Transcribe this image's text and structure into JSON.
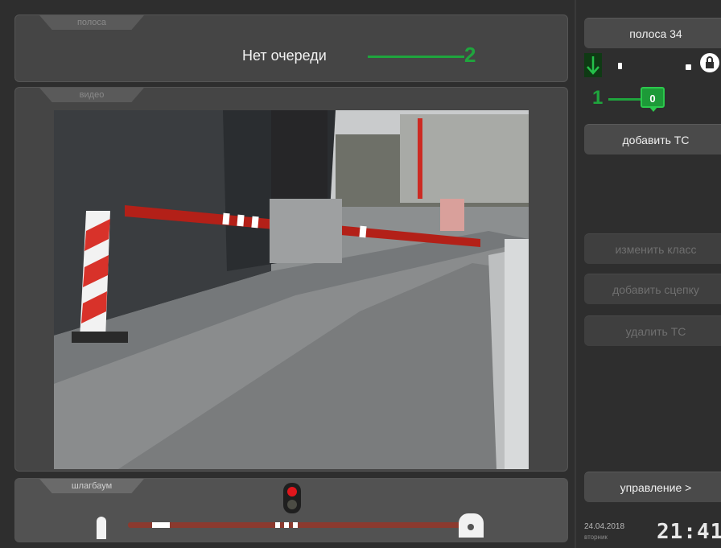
{
  "lane_panel": {
    "tab_label": "полоса",
    "queue_text": "Нет очереди",
    "callout_number": "2"
  },
  "video_panel": {
    "tab_label": "видео"
  },
  "barrier_panel": {
    "tab_label": "шлагбаум",
    "traffic_light_state": "red"
  },
  "sidebar": {
    "lane_button": "полоса 34",
    "callout_number": "1",
    "vehicle_count": "0",
    "add_vehicle_button": "добавить ТС",
    "change_class_button": "изменить класс",
    "add_trailer_button": "добавить сцепку",
    "delete_vehicle_button": "удалить ТС",
    "control_button": "управление >",
    "date": "24.04.2018",
    "weekday": "вторник",
    "time": "21:41"
  },
  "colors": {
    "accent_green": "#1fa53d",
    "signal_red": "#e0161c",
    "boom_red": "#8b3a2f"
  }
}
